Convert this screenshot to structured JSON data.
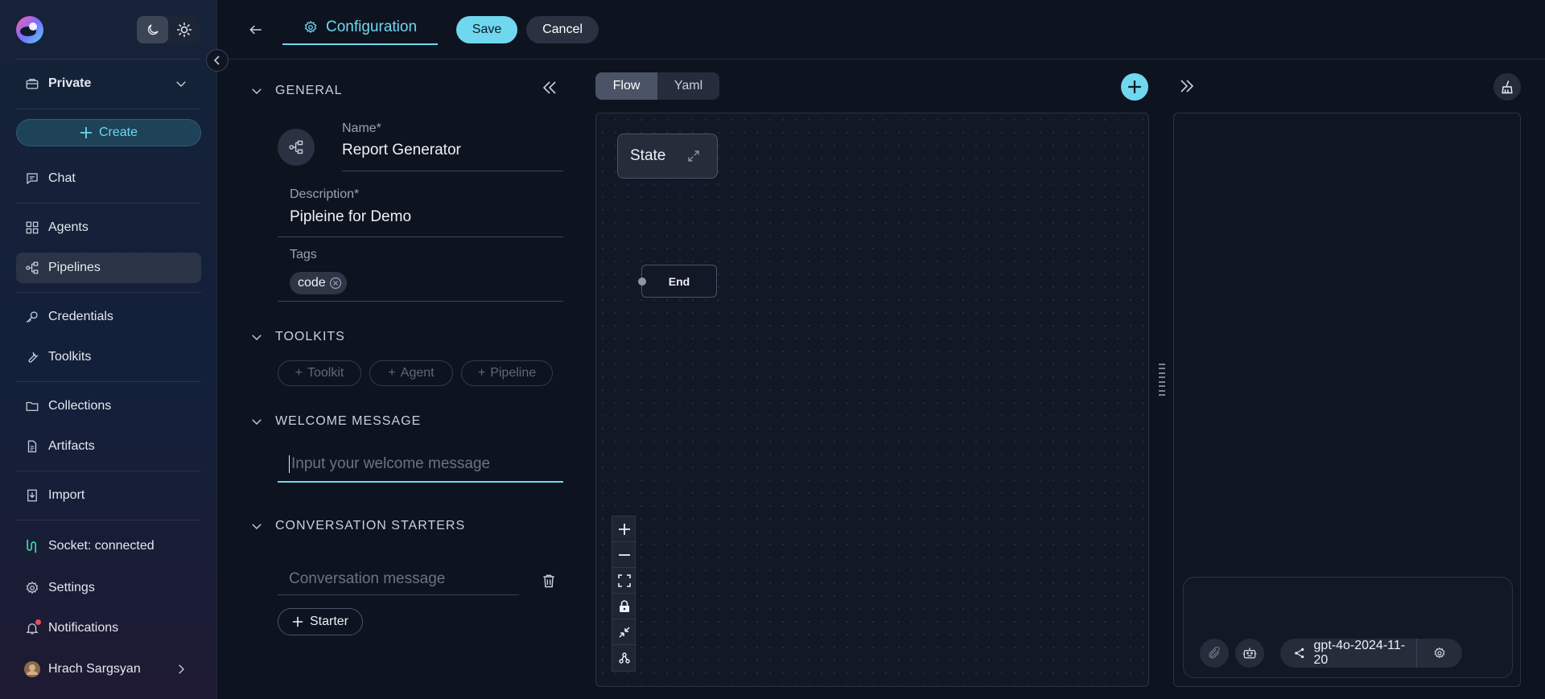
{
  "sidebar": {
    "project": "Private",
    "create_label": "Create",
    "items": [
      {
        "label": "Chat",
        "icon": "chat-icon"
      },
      {
        "label": "Agents",
        "icon": "grid-icon"
      },
      {
        "label": "Pipelines",
        "icon": "pipeline-icon"
      },
      {
        "label": "Credentials",
        "icon": "key-icon"
      },
      {
        "label": "Toolkits",
        "icon": "wrench-icon"
      },
      {
        "label": "Collections",
        "icon": "folder-icon"
      },
      {
        "label": "Artifacts",
        "icon": "file-icon"
      },
      {
        "label": "Import",
        "icon": "import-icon"
      }
    ],
    "socket_status": "Socket: connected",
    "settings_label": "Settings",
    "notifications_label": "Notifications",
    "user_name": "Hrach Sargsyan",
    "accent_color": "#6fd8ef",
    "socket_color": "#3ad29f"
  },
  "header": {
    "tab_label": "Configuration",
    "save_label": "Save",
    "cancel_label": "Cancel"
  },
  "general": {
    "section_title": "GENERAL",
    "name_label": "Name*",
    "name_value": "Report Generator",
    "description_label": "Description*",
    "description_value": "Pipleine for Demo",
    "tags_label": "Tags",
    "tags": [
      "code"
    ]
  },
  "toolkits": {
    "section_title": "TOOLKITS",
    "buttons": [
      "Toolkit",
      "Agent",
      "Pipeline"
    ]
  },
  "welcome": {
    "section_title": "WELCOME MESSAGE",
    "placeholder": "Input your welcome message"
  },
  "starters": {
    "section_title": "CONVERSATION STARTERS",
    "placeholder": "Conversation message",
    "add_label": "Starter"
  },
  "canvas": {
    "view_tabs": [
      "Flow",
      "Yaml"
    ],
    "active_view": "Flow",
    "nodes": {
      "state": "State",
      "end": "End"
    }
  },
  "chat": {
    "model": "gpt-4o-2024-11-20"
  }
}
